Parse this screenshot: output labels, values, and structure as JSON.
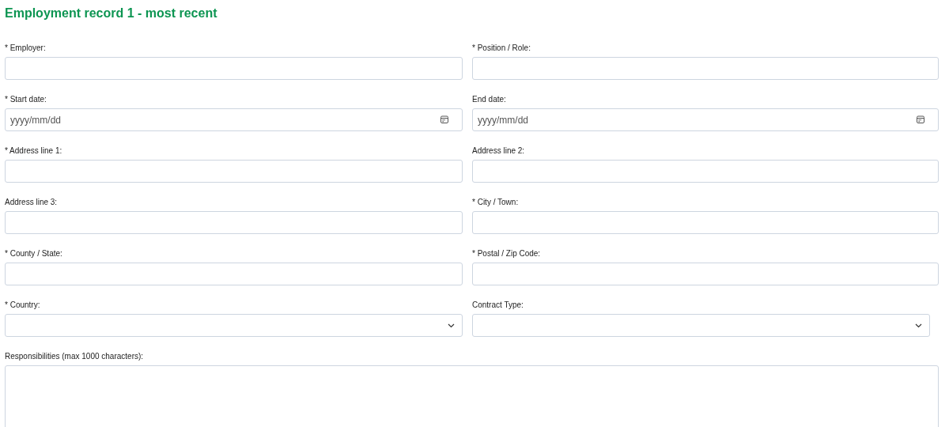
{
  "title": "Employment record 1 - most recent",
  "fields": [
    {
      "label": "* Employer:",
      "kind": "text"
    },
    {
      "label": "* Position / Role:",
      "kind": "text"
    },
    {
      "label": "* Start date:",
      "kind": "date",
      "placeholder": "yyyy/mm/dd"
    },
    {
      "label": "End date:",
      "kind": "date",
      "placeholder": "yyyy/mm/dd"
    },
    {
      "label": "* Address line 1:",
      "kind": "text"
    },
    {
      "label": "Address line 2:",
      "kind": "text"
    },
    {
      "label": "Address line 3:",
      "kind": "text"
    },
    {
      "label": "* City / Town:",
      "kind": "text"
    },
    {
      "label": "* County / State:",
      "kind": "text"
    },
    {
      "label": "* Postal / Zip Code:",
      "kind": "text"
    },
    {
      "label": "* Country:",
      "kind": "select"
    },
    {
      "label": "Contract Type:",
      "kind": "select"
    },
    {
      "label": "Responsibilities (max 1000 characters):",
      "kind": "textarea"
    }
  ]
}
